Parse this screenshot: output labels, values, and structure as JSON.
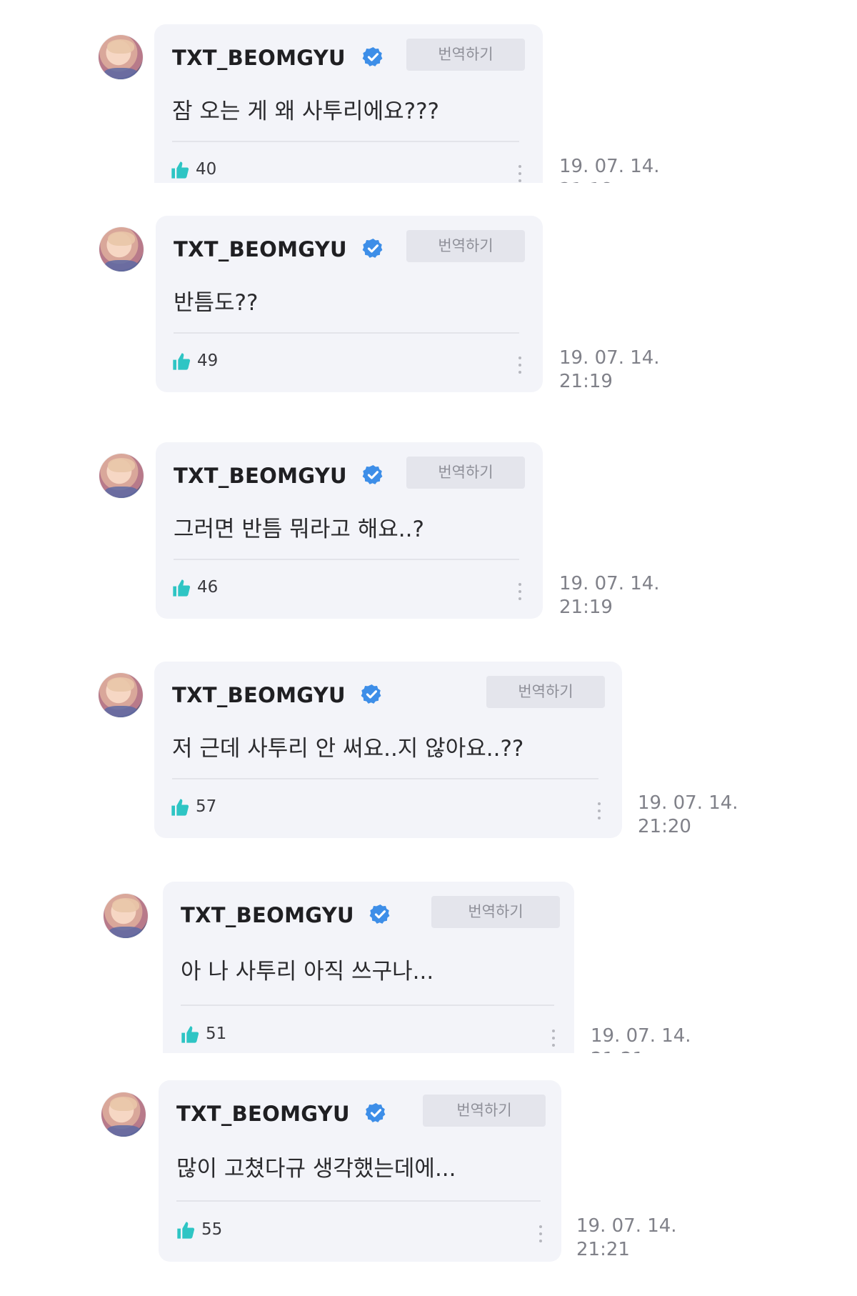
{
  "comments": [
    {
      "username": "TXT_BEOMGYU",
      "translate_label": "번역하기",
      "text": "잠 오는 게 왜 사투리에요???",
      "likes": "40",
      "date": "19. 07. 14.",
      "time": ""
    },
    {
      "username": "TXT_BEOMGYU",
      "translate_label": "번역하기",
      "text": "반틈도??",
      "likes": "49",
      "date": "19. 07. 14.",
      "time": "21:19"
    },
    {
      "username": "TXT_BEOMGYU",
      "translate_label": "번역하기",
      "text": "그러면 반틈 뭐라고 해요..?",
      "likes": "46",
      "date": "19. 07. 14.",
      "time": "21:19"
    },
    {
      "username": "TXT_BEOMGYU",
      "translate_label": "번역하기",
      "text": "저 근데 사투리 안 써요..지 않아요..??",
      "likes": "57",
      "date": "19. 07. 14.",
      "time": "21:20"
    },
    {
      "username": "TXT_BEOMGYU",
      "translate_label": "번역하기",
      "text": "아 나 사투리 아직 쓰구나...",
      "likes": "51",
      "date": "19. 07. 14.",
      "time": ""
    },
    {
      "username": "TXT_BEOMGYU",
      "translate_label": "번역하기",
      "text": "많이 고쳤다규 생각했는데에...",
      "likes": "55",
      "date": "19. 07. 14.",
      "time": "21:21"
    }
  ],
  "colors": {
    "bubble": "#f3f4f9",
    "verified": "#3d8ee8",
    "like": "#2ec5c4",
    "translate_bg": "#e4e5ec",
    "timestamp": "#808189"
  },
  "icons": {
    "verified": "verified-badge-icon",
    "like": "thumbs-up-icon",
    "more": "more-vertical-icon"
  }
}
